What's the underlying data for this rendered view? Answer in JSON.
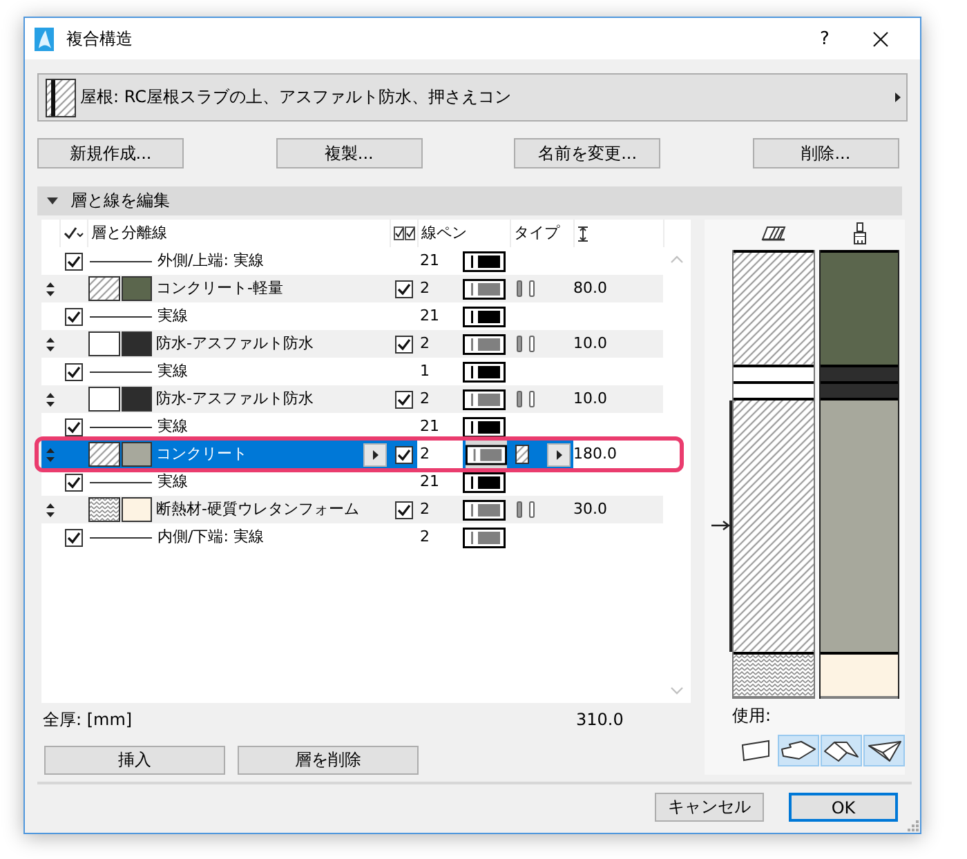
{
  "window": {
    "title": "複合構造",
    "help_button": "?"
  },
  "composite": {
    "name": "屋根: RC屋根スラブの上、アスファルト防水、押さえコン"
  },
  "buttons": [
    "新規作成...",
    "複製...",
    "名前を変更...",
    "削除..."
  ],
  "section": {
    "title": "層と線を編集",
    "expanded": true
  },
  "table": {
    "columns": {
      "name": "層と分離線",
      "pen": "線ペン",
      "type": "タイプ"
    },
    "rows": [
      {
        "kind": "line",
        "label": "外側/上端: 実線",
        "checked": true,
        "pen": {
          "number": "21",
          "color": "#000000"
        },
        "selected": false,
        "highlighted": false
      },
      {
        "kind": "layer",
        "hatch": {
          "kind": "diagonal"
        },
        "color": "#5b664d",
        "name": "コンクリート-軽量",
        "checked": true,
        "pen": {
          "number": "2",
          "color": "#808080"
        },
        "core": false,
        "thickness": "80.0",
        "selected": false,
        "highlighted": false
      },
      {
        "kind": "line",
        "label": "実線",
        "checked": true,
        "pen": {
          "number": "21",
          "color": "#000000"
        },
        "selected": false,
        "highlighted": false
      },
      {
        "kind": "layer",
        "hatch": {
          "kind": "blank"
        },
        "color": "#2d2d2d",
        "name": "防水-アスファルト防水",
        "checked": true,
        "pen": {
          "number": "2",
          "color": "#808080"
        },
        "core": false,
        "thickness": "10.0",
        "selected": false,
        "highlighted": false
      },
      {
        "kind": "line",
        "label": "実線",
        "checked": true,
        "pen": {
          "number": "1",
          "color": "#000000"
        },
        "selected": false,
        "highlighted": false
      },
      {
        "kind": "layer",
        "hatch": {
          "kind": "blank"
        },
        "color": "#2d2d2d",
        "name": "防水-アスファルト防水",
        "checked": true,
        "pen": {
          "number": "2",
          "color": "#808080"
        },
        "core": false,
        "thickness": "10.0",
        "selected": false,
        "highlighted": false
      },
      {
        "kind": "line",
        "label": "実線",
        "checked": true,
        "pen": {
          "number": "21",
          "color": "#000000"
        },
        "selected": false,
        "highlighted": false
      },
      {
        "kind": "layer",
        "hatch": {
          "kind": "diagonal"
        },
        "color": "#a7a89c",
        "name": "コンクリート",
        "checked": true,
        "pen": {
          "number": "2",
          "color": "#808080"
        },
        "core": true,
        "thickness": "180.0",
        "selected": true,
        "highlighted": true
      },
      {
        "kind": "line",
        "label": "実線",
        "checked": true,
        "pen": {
          "number": "21",
          "color": "#000000"
        },
        "selected": false,
        "highlighted": false
      },
      {
        "kind": "layer",
        "hatch": {
          "kind": "zigzag"
        },
        "color": "#fdf3e3",
        "name": "断熱材-硬質ウレタンフォーム",
        "checked": true,
        "pen": {
          "number": "2",
          "color": "#808080"
        },
        "core": false,
        "thickness": "30.0",
        "selected": false,
        "highlighted": false
      },
      {
        "kind": "line",
        "label": "内側/下端: 実線",
        "checked": true,
        "pen": {
          "number": "2",
          "color": "#808080"
        },
        "selected": false,
        "highlighted": false
      }
    ]
  },
  "total": {
    "label": "全厚: [mm]",
    "value": "310.0"
  },
  "layer_buttons": [
    "挿入",
    "層を削除"
  ],
  "preview": {
    "usage_label": "使用:",
    "usage": [
      {
        "kind": "wall",
        "selected": false
      },
      {
        "kind": "slab",
        "selected": true
      },
      {
        "kind": "roof",
        "selected": true
      },
      {
        "kind": "shell",
        "selected": true
      }
    ]
  },
  "dialog_buttons": [
    {
      "label": "キャンセル",
      "default": false
    },
    {
      "label": "OK",
      "default": true
    }
  ]
}
